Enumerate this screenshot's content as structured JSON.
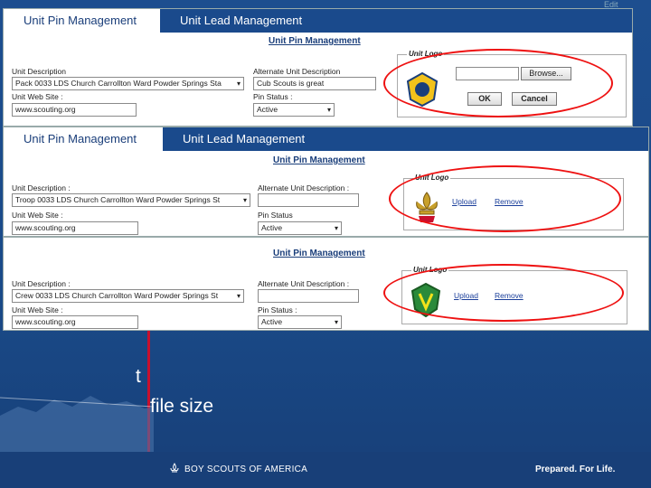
{
  "slide": {
    "bullet_line1": "t",
    "bullet_line2": "file size",
    "footer_brand": "BOY SCOUTS OF AMERICA",
    "footer_tagline": "Prepared. For Life.",
    "edit_link": "Edit"
  },
  "panels": [
    {
      "tab_pin": "Unit Pin Management",
      "tab_lead": "Unit Lead Management",
      "title": "Unit Pin Management",
      "unit_desc_label": "Unit Description",
      "unit_desc_value": "Pack 0033 LDS Church Carrollton Ward Powder Springs Sta",
      "alt_desc_label": "Alternate Unit Description",
      "alt_desc_value": "Cub Scouts is great",
      "web_label": "Unit Web Site :",
      "web_value": "www.scouting.org",
      "pin_status_label": "Pin Status :",
      "pin_status_value": "Active",
      "logo_legend": "Unit Logo",
      "browse_label": "Browse...",
      "ok_label": "OK",
      "cancel_label": "Cancel"
    },
    {
      "tab_pin": "Unit Pin Management",
      "tab_lead": "Unit Lead Management",
      "title": "Unit Pin Management",
      "unit_desc_label": "Unit Description :",
      "unit_desc_value": "Troop 0033 LDS Church Carrollton Ward Powder Springs St",
      "alt_desc_label": "Alternate Unit Description :",
      "alt_desc_value": "",
      "web_label": "Unit Web Site :",
      "web_value": "www.scouting.org",
      "pin_status_label": "Pin Status",
      "pin_status_value": "Active",
      "logo_legend": "Unit Logo",
      "upload_label": "Upload",
      "remove_label": "Remove"
    },
    {
      "title": "Unit Pin Management",
      "unit_desc_label": "Unit Description :",
      "unit_desc_value": "Crew 0033 LDS Church Carrollton Ward Powder Springs St",
      "alt_desc_label": "Alternate Unit Description :",
      "alt_desc_value": "",
      "web_label": "Unit Web Site :",
      "web_value": "www.scouting.org",
      "pin_status_label": "Pin Status :",
      "pin_status_value": "Active",
      "logo_legend": "Unit Logo",
      "upload_label": "Upload",
      "remove_label": "Remove"
    }
  ],
  "colors": {
    "background": "#1e4c8c",
    "highlight_oval": "#e11111",
    "tab_active_text": "#1a3e7a"
  }
}
